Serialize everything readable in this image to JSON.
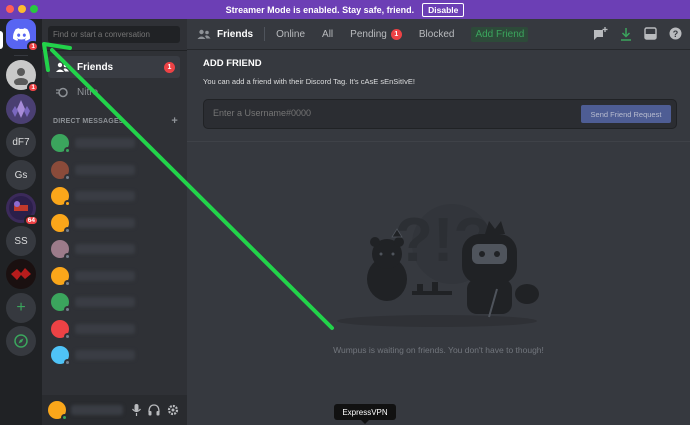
{
  "banner": {
    "message": "Streamer Mode is enabled. Stay safe, friend.",
    "disable_label": "Disable"
  },
  "rail": {
    "servers": [
      {
        "label": "",
        "badge": "1",
        "color": "#5865f2"
      },
      {
        "label": "",
        "badge": "1",
        "color": "#c9c9c9"
      },
      {
        "label": "",
        "badge": "",
        "color": "#6b5a9a"
      },
      {
        "label": "dF7",
        "badge": "",
        "color": "#36393f"
      },
      {
        "label": "Gs",
        "badge": "",
        "color": "#36393f"
      },
      {
        "label": "",
        "badge": "64",
        "color": "#3b2a5a"
      },
      {
        "label": "SS",
        "badge": "",
        "color": "#36393f"
      },
      {
        "label": "",
        "badge": "",
        "color": "#2a1a1a"
      }
    ],
    "add_symbol": "+",
    "explore_symbol": "✦"
  },
  "dms": {
    "search_placeholder": "Find or start a conversation",
    "friends_label": "Friends",
    "friends_badge": "1",
    "nitro_label": "Nitro",
    "header": "DIRECT MESSAGES",
    "header_add": "+",
    "rows": [
      {
        "color": "#3ba55d",
        "status": "#3ba55d"
      },
      {
        "color": "#8a4b3a",
        "status": "#747f8d"
      },
      {
        "color": "#faa61a",
        "status": "#faa61a"
      },
      {
        "color": "#faa61a",
        "status": "#747f8d"
      },
      {
        "color": "#9c7b8a",
        "status": "#747f8d"
      },
      {
        "color": "#faa61a",
        "status": "#747f8d"
      },
      {
        "color": "#3ba55d",
        "status": "#747f8d"
      },
      {
        "color": "#ed4245",
        "status": "#747f8d"
      },
      {
        "color": "#4fc3f7",
        "status": "#747f8d"
      }
    ]
  },
  "topbar": {
    "friends_label": "Friends",
    "tabs": [
      "Online",
      "All"
    ],
    "pending_label": "Pending",
    "pending_badge": "1",
    "blocked_label": "Blocked",
    "add_friend_label": "Add Friend"
  },
  "add_friend": {
    "title": "ADD FRIEND",
    "description": "You can add a friend with their Discord Tag. It's cAsE sEnSitIvE!",
    "input_placeholder": "Enter a Username#0000",
    "button_label": "Send Friend Request"
  },
  "empty_state": {
    "message": "Wumpus is waiting on friends. You don't have to though!"
  },
  "tooltip": {
    "label": "ExpressVPN"
  }
}
